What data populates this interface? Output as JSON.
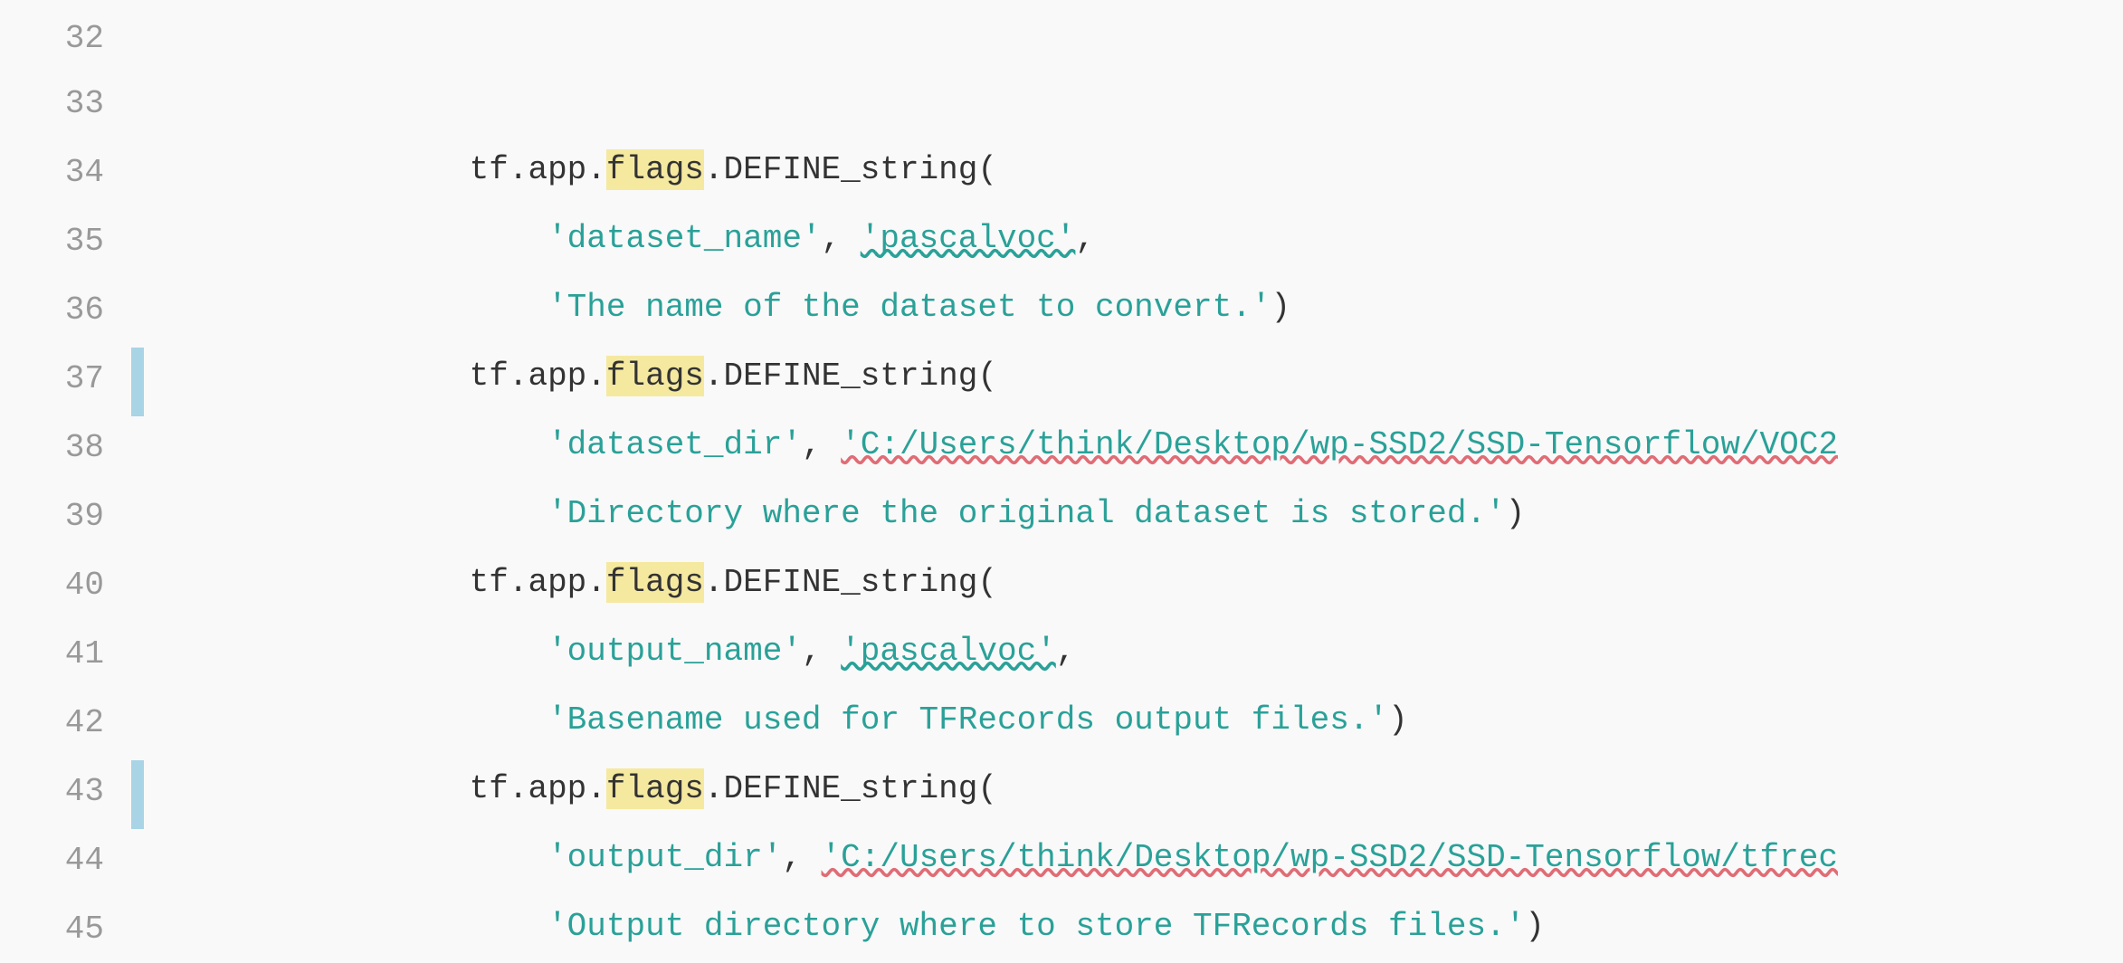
{
  "editor": {
    "background": "#f9f9f9",
    "lines": [
      {
        "number": "32",
        "indent": "",
        "content": "",
        "hasIndicator": false
      },
      {
        "number": "33",
        "indent": "        ",
        "content": "tf.app.__FLAGS__.DEFINE_string(",
        "hasIndicator": false
      },
      {
        "number": "34",
        "indent": "            ",
        "content": "'dataset_name', 'pascalvoc',",
        "hasIndicator": false
      },
      {
        "number": "35",
        "indent": "            ",
        "content": "'The name of the dataset to convert.')",
        "hasIndicator": false
      },
      {
        "number": "36",
        "indent": "        ",
        "content": "tf.app.__FLAGS__.DEFINE_string(",
        "hasIndicator": false
      },
      {
        "number": "37",
        "indent": "            ",
        "content": "'dataset_dir', 'C:/Users/think/Desktop/wp-SSD2/SSD-Tensorflow/VOC2",
        "hasIndicator": true
      },
      {
        "number": "38",
        "indent": "            ",
        "content": "'Directory where the original dataset is stored.')",
        "hasIndicator": false
      },
      {
        "number": "39",
        "indent": "        ",
        "content": "tf.app.__FLAGS__.DEFINE_string(",
        "hasIndicator": false
      },
      {
        "number": "40",
        "indent": "            ",
        "content": "'output_name', 'pascalvoc',",
        "hasIndicator": false
      },
      {
        "number": "41",
        "indent": "            ",
        "content": "'Basename used for TFRecords output files.')",
        "hasIndicator": false
      },
      {
        "number": "42",
        "indent": "        ",
        "content": "tf.app.__FLAGS__.DEFINE_string(",
        "hasIndicator": false
      },
      {
        "number": "43",
        "indent": "            ",
        "content": "'output_dir', 'C:/Users/think/Desktop/wp-SSD2/SSD-Tensorflow/tfrec",
        "hasIndicator": true
      },
      {
        "number": "44",
        "indent": "            ",
        "content": "'Output directory where to store TFRecords files.')",
        "hasIndicator": false
      },
      {
        "number": "45",
        "indent": "",
        "content": "",
        "hasIndicator": false
      }
    ]
  }
}
